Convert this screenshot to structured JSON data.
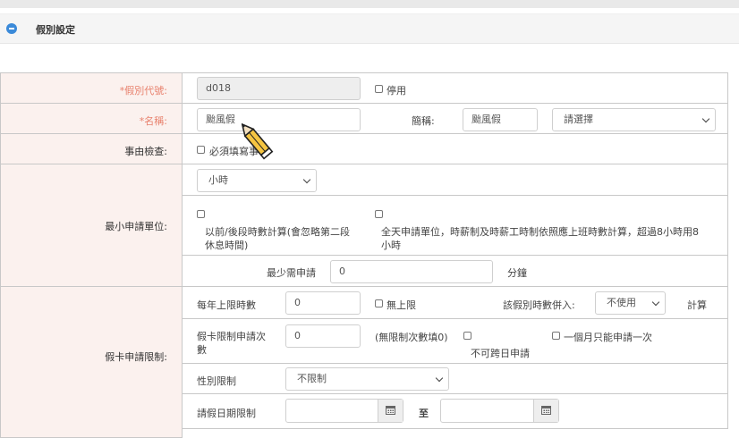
{
  "header": {
    "title": "假別設定"
  },
  "leave_code": {
    "label": "*假別代號:",
    "value": "d018",
    "disable_label": "停用"
  },
  "name": {
    "label": "*名稱:",
    "value": "颱風假",
    "short_label": "簡稱:",
    "short_value": "颱風假",
    "select_value": "請選擇"
  },
  "reason_check": {
    "label": "事由檢查:",
    "checkbox_label": "必須填寫事"
  },
  "min_unit": {
    "label": "最小申請單位:",
    "unit_select": "小時",
    "option_a": "以前/後段時數計算(會忽略第二段休息時間)",
    "option_a_line1": "以前/後段時數計算(會忽略第二段",
    "option_a_line2": "休息時間)",
    "option_b_line1": "全天申請單位，時薪制及時薪工時制依照應上班時數計算，超過8小時用8",
    "option_b_line2": "小時",
    "min_request_label": "最少需申請",
    "min_request_value": "0",
    "min_request_unit": "分鐘"
  },
  "leave_limit": {
    "label": "假卡申請限制:",
    "annual_max_label": "每年上限時數",
    "annual_max_value": "0",
    "no_limit_label": "無上限",
    "merge_label": "該假別時數併入:",
    "merge_select": "不使用",
    "calc_label": "計算",
    "count_limit_label_line1": "假卡限制申請次",
    "count_limit_label_line2": "數",
    "count_limit_value": "0",
    "count_limit_hint": "(無限制次數填0)",
    "no_cross_day_label": "不可跨日申請",
    "once_per_month_label": "一個月只能申請一次",
    "gender_label": "性別限制",
    "gender_select": "不限制",
    "date_limit_label": "請假日期限制",
    "date_to_label": "至"
  },
  "colors": {
    "label_bg": "#fbf1ee",
    "required_text": "#e8826e",
    "accent": "#3b8ad9"
  }
}
